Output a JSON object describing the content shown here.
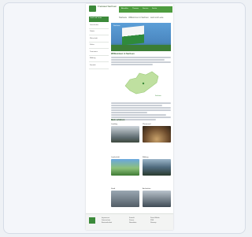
{
  "window": {
    "frame_color": "#f4f6fa"
  },
  "site": {
    "logo_text": "Freistaat Sachsen",
    "nav": [
      "Aktuelles",
      "Themen",
      "Service",
      "Suche"
    ],
    "breadcrumb": "Startseite · Willkommen in Sachsen · Land und Leute",
    "accent": "#3c8a3a"
  },
  "sidebar": {
    "items": [
      "Land und Leute",
      "Geschichte",
      "Politik",
      "Wirtschaft",
      "Kultur",
      "Tourismus",
      "Bildung",
      "Kontakt"
    ]
  },
  "hero": {
    "caption": "Sachsen"
  },
  "content": {
    "heading_intro": "Willkommen in Sachsen",
    "map_label": "Sachsen",
    "heading_more": "Mehr erfahren"
  },
  "tiles": [
    {
      "caption": "Landtag"
    },
    {
      "caption": "Plenarsaal"
    },
    {
      "caption": "Landschaft"
    },
    {
      "caption": "Bildung"
    },
    {
      "caption": "Stadt"
    },
    {
      "caption": "Architektur"
    }
  ],
  "footer": {
    "col1": [
      "Impressum",
      "Datenschutz",
      "Barrierefreiheit"
    ],
    "col2": [
      "Kontakt",
      "Presse",
      "Newsletter"
    ],
    "col3": [
      "Social Media",
      "RSS",
      "Sitemap"
    ]
  }
}
